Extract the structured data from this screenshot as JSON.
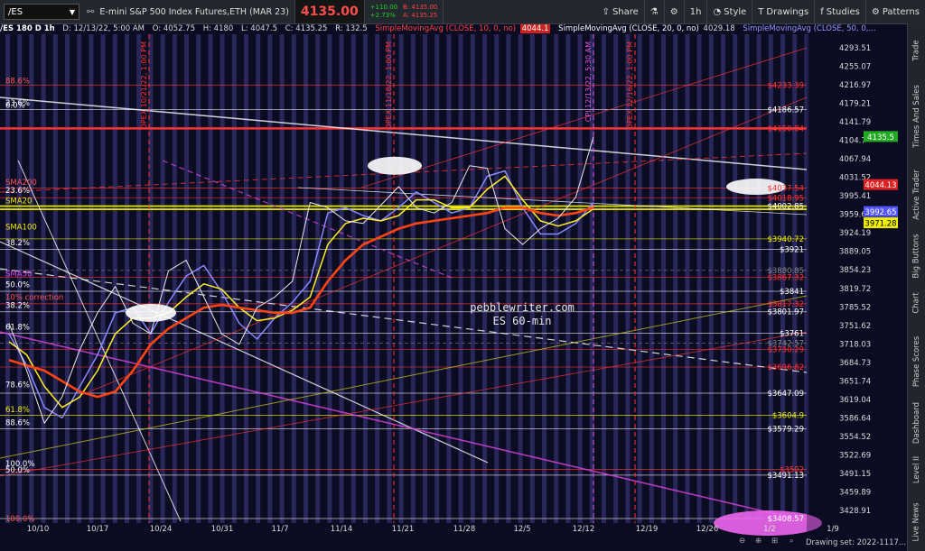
{
  "toolbar": {
    "symbol": "/ES",
    "description": "E-mini S&P 500 Index Futures,ETH (MAR 23)",
    "last_price": "4135.00",
    "change_up": "+110.00",
    "change_pct": "+2.73%",
    "bid": "B: 4135.00",
    "ask": "A: 4135.25",
    "share_label": "Share",
    "timeframe": "1h",
    "style_label": "Style",
    "drawings_label": "Drawings",
    "studies_label": "Studies",
    "patterns_label": "Patterns"
  },
  "status": {
    "header": "/ES 180 D 1h",
    "date": "D: 12/13/22, 5:00 AM",
    "open": "O: 4052.75",
    "high": "H: 4180",
    "low": "L: 4047.5",
    "close": "C: 4135.25",
    "range": "R: 132.5",
    "sma10": "SimpleMovingAvg (CLOSE, 10, 0, no)",
    "sma10_val": "4044.1",
    "sma20": "SimpleMovingAvg (CLOSE, 20, 0, no)",
    "sma20_val": "4029.18",
    "sma50": "SimpleMovingAvg (CLOSE, 50, 0,..."
  },
  "sidebar": {
    "tabs": [
      "Trade",
      "Times And Sales",
      "Active Trader",
      "Big Buttons",
      "Chart",
      "Phase Scores",
      "Dashboard",
      "Level II",
      "Live News"
    ]
  },
  "watermark": {
    "line1": "pebblewriter.com",
    "line2": "ES 60-min"
  },
  "bottom": {
    "drawing_set": "Drawing set: 2022-1117..."
  },
  "colors": {
    "background": "#0b0b22",
    "vertical_stripes": "#3f3f88",
    "sma10": "#8888ff",
    "sma20": "#ffee22",
    "sma50": "#ff4411",
    "fib_red": "#ff3333",
    "yellow_line": "#dddd00",
    "magenta": "#dd44dd"
  },
  "chart_data": {
    "type": "line",
    "symbol": "/ES",
    "interval": "60-min",
    "x_ticks": [
      "10/10",
      "10/17",
      "10/24",
      "10/31",
      "11/7",
      "11/14",
      "11/21",
      "11/28",
      "12/5",
      "12/12",
      "12/19",
      "12/26",
      "1/2",
      "1/9"
    ],
    "y_range": [
      3400,
      4330
    ],
    "y_ticks": [
      "4293.51",
      "4255.07",
      "4216.97",
      "4179.21",
      "4141.79",
      "4104.7",
      "4067.94",
      "4031.52",
      "3995.41",
      "3959.64",
      "3924.19",
      "3889.05",
      "3854.23",
      "3819.72",
      "3785.52",
      "3751.62",
      "3718.03",
      "3684.73",
      "3651.74",
      "3619.04",
      "3586.64",
      "3554.52",
      "3522.69",
      "3491.15",
      "3459.89",
      "3428.91"
    ],
    "price_badges": [
      {
        "label": "4135.5",
        "value": 4135.5,
        "color": "#22aa22"
      },
      {
        "label": "4044.13",
        "value": 4044.13,
        "color": "#dd2222"
      },
      {
        "label": "3992.65",
        "value": 3992.65,
        "color": "#5555ff"
      },
      {
        "label": "3971.28",
        "value": 3971.28,
        "color": "#eeee00"
      }
    ],
    "level_labels": [
      {
        "label": "$4233.39",
        "value": 4233.39,
        "color": "#ff3333"
      },
      {
        "label": "$4186.57",
        "value": 4186.57,
        "color": "#ffffff"
      },
      {
        "label": "$4150.84",
        "value": 4150.84,
        "color": "#ff3333"
      },
      {
        "label": "$4037.54",
        "value": 4037.54,
        "color": "#ff3333"
      },
      {
        "label": "$4018.95",
        "value": 4018.95,
        "color": "#ff3333"
      },
      {
        "label": "$4002.85",
        "value": 4002.85,
        "color": "#ffffff"
      },
      {
        "label": "$3940.72",
        "value": 3940.72,
        "color": "#eeee00"
      },
      {
        "label": "$3921",
        "value": 3921,
        "color": "#ffffff"
      },
      {
        "label": "$3880.85",
        "value": 3880.85,
        "color": "#888888"
      },
      {
        "label": "$3867.32",
        "value": 3867.32,
        "color": "#ff3333"
      },
      {
        "label": "$3841",
        "value": 3841,
        "color": "#ffffff"
      },
      {
        "label": "$3817.32",
        "value": 3817.32,
        "color": "#ff3333"
      },
      {
        "label": "$3801.97",
        "value": 3801.97,
        "color": "#ffffff"
      },
      {
        "label": "$3761",
        "value": 3761,
        "color": "#ffffff"
      },
      {
        "label": "$3742.57",
        "value": 3742.57,
        "color": "#888888"
      },
      {
        "label": "$3730.29",
        "value": 3730.29,
        "color": "#ff3333"
      },
      {
        "label": "$3696.82",
        "value": 3696.82,
        "color": "#ff3333"
      },
      {
        "label": "$3647.09",
        "value": 3647.09,
        "color": "#ffffff"
      },
      {
        "label": "$3604.9",
        "value": 3604.9,
        "color": "#eeee00"
      },
      {
        "label": "$3579.29",
        "value": 3579.29,
        "color": "#ffffff"
      },
      {
        "label": "$3502",
        "value": 3502,
        "color": "#ff3333"
      },
      {
        "label": "$3491.13",
        "value": 3491.13,
        "color": "#ffffff"
      },
      {
        "label": "$3408.57",
        "value": 3408.57,
        "color": "#ffffff"
      }
    ],
    "left_labels": [
      {
        "label": "88.6%",
        "value": 4233.39,
        "color": "#ff5555"
      },
      {
        "label": "23.6%",
        "value": 4191,
        "color": "#ffffff"
      },
      {
        "label": "0.0%",
        "value": 4186.57,
        "color": "#ffffff"
      },
      {
        "label": "SMA200",
        "value": 4040,
        "color": "#ff5555"
      },
      {
        "label": "23.6%",
        "value": 4025,
        "color": "#ffffff"
      },
      {
        "label": "SMA20",
        "value": 4005,
        "color": "#eeee00"
      },
      {
        "label": "SMA100",
        "value": 3955,
        "color": "#eeee00"
      },
      {
        "label": "38.2%",
        "value": 3925,
        "color": "#ffffff"
      },
      {
        "label": "SMA50",
        "value": 3866,
        "color": "#dd44dd"
      },
      {
        "label": "50.0%",
        "value": 3845,
        "color": "#ffffff"
      },
      {
        "label": "10% correction",
        "value": 3821,
        "color": "#ff5555"
      },
      {
        "label": "38.2%",
        "value": 3806,
        "color": "#ffffff"
      },
      {
        "label": "61.8%",
        "value": 3765,
        "color": "#ffffff"
      },
      {
        "label": "78.6%",
        "value": 3655,
        "color": "#ffffff"
      },
      {
        "label": "61.8%",
        "value": 3608,
        "color": "#eeee00"
      },
      {
        "label": "88.6%",
        "value": 3583,
        "color": "#ffffff"
      },
      {
        "label": "100.0%",
        "value": 3505,
        "color": "#ffffff"
      },
      {
        "label": "50.0%",
        "value": 3493,
        "color": "#ffffff"
      },
      {
        "label": "100.0%",
        "value": 3400,
        "color": "#ff5555"
      }
    ],
    "event_lines": [
      {
        "label": "OPEX 10/21/22, 1:00 PM",
        "color": "#ff3333"
      },
      {
        "label": "OPEX 11/18/22, 1:00 PM",
        "color": "#ff3333"
      },
      {
        "label": "CPI 12/13/22, 5:30 AM",
        "color": "#dd55dd"
      },
      {
        "label": "OPEX 12/16/22, 1:00 PM",
        "color": "#ff3333"
      }
    ],
    "series": [
      {
        "name": "SMA10",
        "color": "#8888ff",
        "values": [
          3760,
          3700,
          3620,
          3600,
          3660,
          3720,
          3800,
          3810,
          3760,
          3820,
          3870,
          3890,
          3840,
          3780,
          3750,
          3790,
          3820,
          3860,
          3990,
          4000,
          3985,
          3975,
          4000,
          4030,
          4010,
          3990,
          4000,
          4060,
          4070,
          4000,
          3950,
          3950,
          3970,
          4010
        ]
      },
      {
        "name": "SMA20",
        "color": "#ffee22",
        "values": [
          3745,
          3720,
          3660,
          3620,
          3640,
          3690,
          3760,
          3790,
          3790,
          3800,
          3830,
          3855,
          3845,
          3810,
          3785,
          3790,
          3805,
          3830,
          3930,
          3970,
          3980,
          3975,
          3985,
          4015,
          4015,
          4000,
          4000,
          4035,
          4060,
          4015,
          3975,
          3965,
          3975,
          3998
        ]
      },
      {
        "name": "SMA50",
        "color": "#ff4411",
        "values": [
          3710,
          3700,
          3690,
          3670,
          3650,
          3640,
          3650,
          3690,
          3740,
          3770,
          3790,
          3810,
          3815,
          3810,
          3805,
          3800,
          3800,
          3810,
          3860,
          3900,
          3930,
          3945,
          3960,
          3970,
          3975,
          3980,
          3985,
          3990,
          4000,
          4000,
          3990,
          3985,
          3990,
          4000
        ]
      },
      {
        "name": "Price",
        "color": "#e8e8e8",
        "values": [
          3780,
          3690,
          3590,
          3640,
          3730,
          3800,
          3850,
          3780,
          3760,
          3880,
          3900,
          3830,
          3760,
          3740,
          3810,
          3830,
          3860,
          4010,
          4000,
          3975,
          3970,
          4005,
          4040,
          4000,
          3990,
          4010,
          4080,
          4075,
          3960,
          3930,
          3960,
          3980,
          4020,
          4135
        ]
      }
    ]
  }
}
